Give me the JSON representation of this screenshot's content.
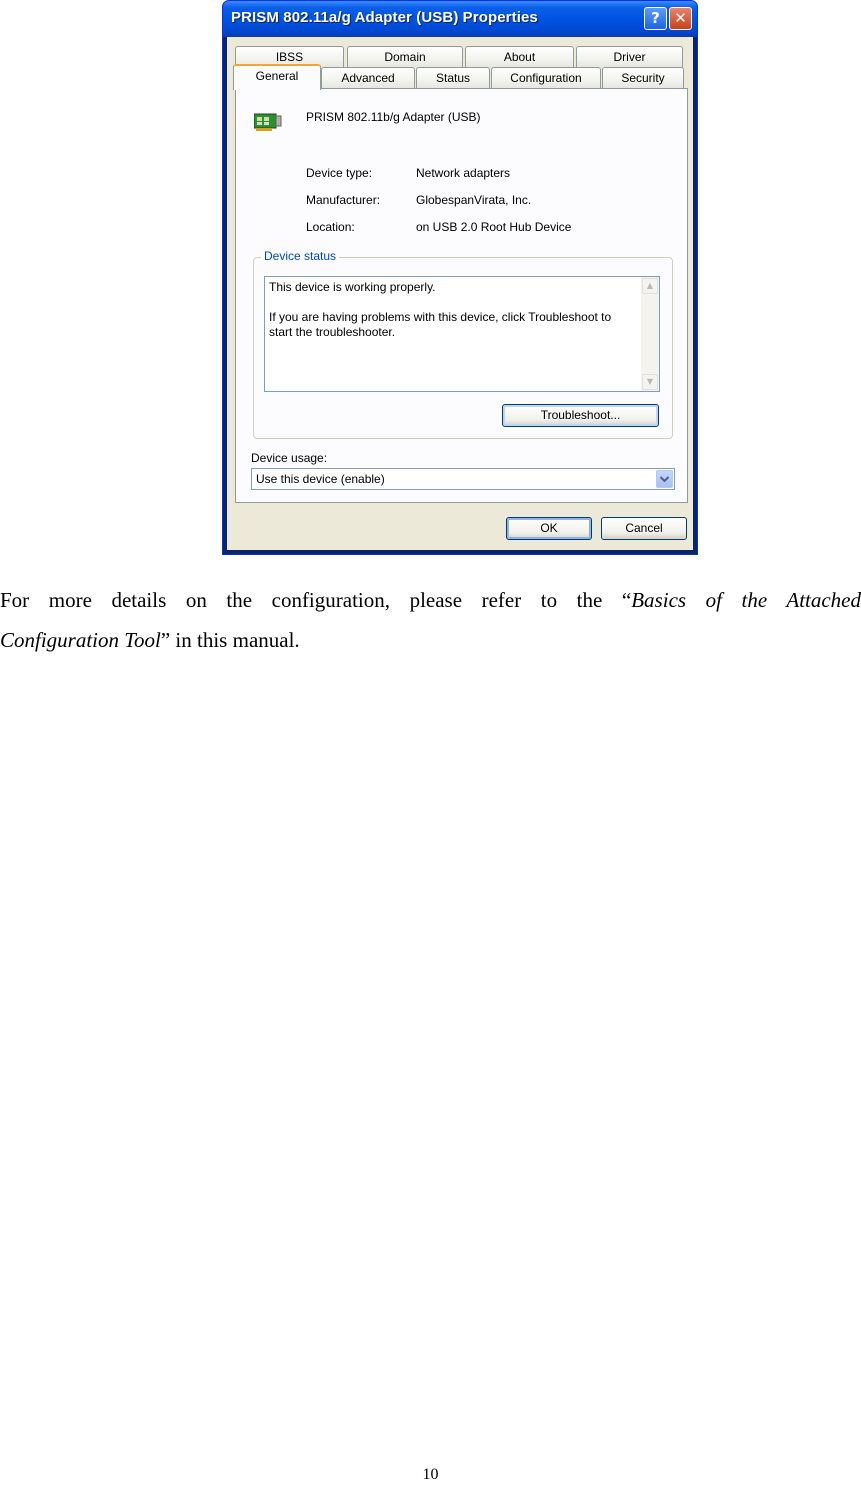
{
  "dialog": {
    "title": "PRISM 802.11a/g Adapter (USB) Properties",
    "help_symbol": "?",
    "close_symbol": "✕",
    "tabs_back_row": [
      "IBSS",
      "Domain",
      "About",
      "Driver"
    ],
    "tabs_front_row": [
      "General",
      "Advanced",
      "Status",
      "Configuration",
      "Security"
    ],
    "active_tab": "General",
    "device_name": "PRISM 802.11b/g Adapter (USB)",
    "properties": [
      {
        "label": "Device type:",
        "value": "Network adapters"
      },
      {
        "label": "Manufacturer:",
        "value": "GlobespanVirata, Inc."
      },
      {
        "label": "Location:",
        "value": "on USB 2.0 Root Hub Device"
      }
    ],
    "device_status": {
      "group_label": "Device status",
      "line1": "This device is working properly.",
      "line2": "If you are having problems with this device, click Troubleshoot to",
      "line3": "start the troubleshooter."
    },
    "troubleshoot_button": "Troubleshoot...",
    "device_usage_label": "Device usage:",
    "device_usage_value": "Use this device (enable)",
    "ok_button": "OK",
    "cancel_button": "Cancel",
    "accent_color": "#0054e3"
  },
  "document": {
    "paragraph_start": "For more details on the configuration, please refer to the “",
    "reference_part1": "Basics of the Attached",
    "reference_part2": "Configuration Tool",
    "paragraph_end": "” in this manual.",
    "page_number": "10"
  }
}
